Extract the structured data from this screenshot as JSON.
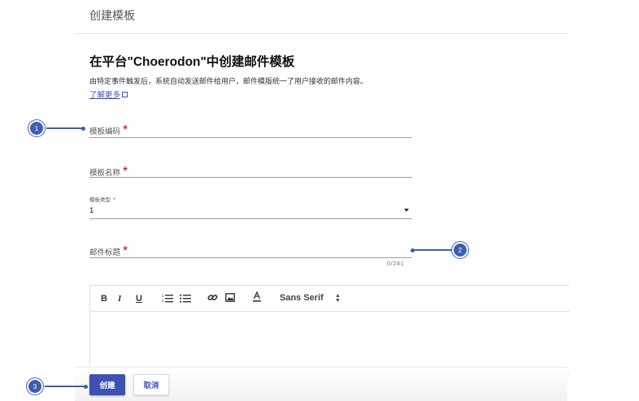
{
  "header": {
    "title": "创建模板"
  },
  "main": {
    "heading": "在平台\"Choerodon\"中创建邮件模板",
    "description": "由特定事件触发后，系统自动发送邮件给用户，邮件模版统一了用户接收的邮件内容。",
    "learn_more": "了解更多"
  },
  "form": {
    "code_label": "模板编码",
    "name_label": "模板名称",
    "type_label": "模板类型",
    "type_value": "1",
    "subject_label": "邮件标题",
    "subject_counter": "0/241",
    "required_mark": "*"
  },
  "editor": {
    "bold": "B",
    "italic": "I",
    "underline": "U",
    "font": "Sans Serif",
    "icons": [
      "ordered-list-icon",
      "bullet-list-icon",
      "link-icon",
      "image-icon",
      "text-color-icon"
    ]
  },
  "actions": {
    "create": "创建",
    "cancel": "取消"
  },
  "callouts": [
    "1",
    "2",
    "3"
  ],
  "colors": {
    "primary": "#3f51b5",
    "callout": "#3f5fae",
    "required": "#d50000"
  }
}
